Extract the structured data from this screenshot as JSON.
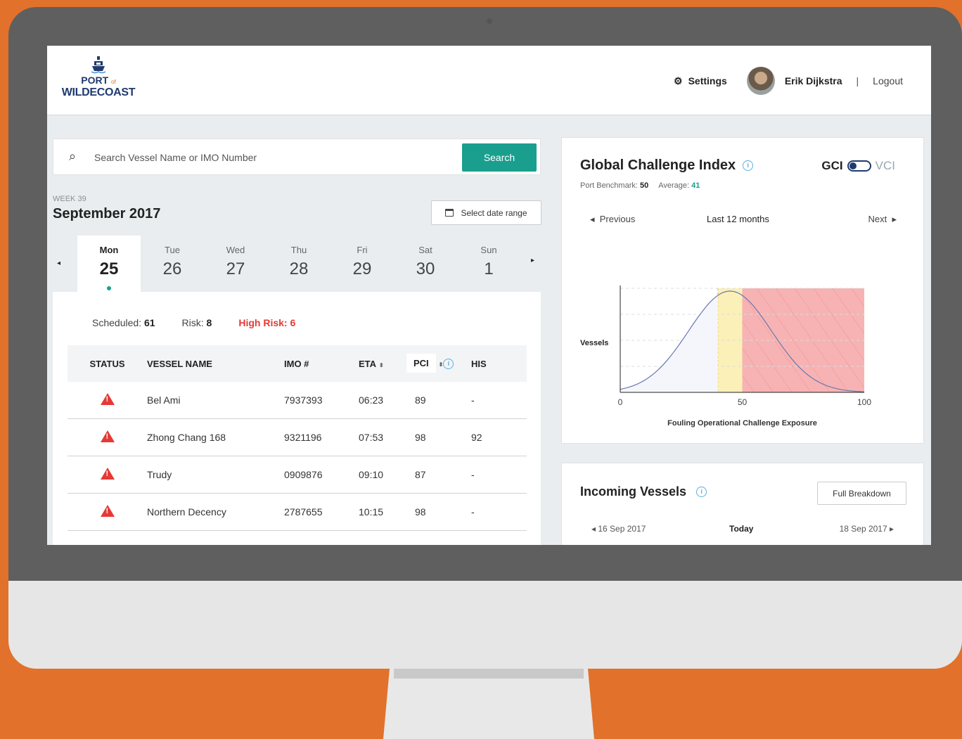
{
  "header": {
    "logo_top": "PORT",
    "logo_of": "of",
    "logo_bottom": "WILDECOAST",
    "settings_label": "Settings",
    "user_name": "Erik Dijkstra",
    "separator": "|",
    "logout_label": "Logout"
  },
  "search": {
    "placeholder": "Search Vessel Name or IMO Number",
    "value": "",
    "button_label": "Search"
  },
  "calendar": {
    "week_label": "WEEK 39",
    "month_title": "September 2017",
    "date_range_label": "Select date range",
    "prev_arrow": "◂",
    "next_arrow": "▸",
    "days": [
      {
        "name": "Mon",
        "num": "25",
        "active": true
      },
      {
        "name": "Tue",
        "num": "26"
      },
      {
        "name": "Wed",
        "num": "27"
      },
      {
        "name": "Thu",
        "num": "28"
      },
      {
        "name": "Fri",
        "num": "29"
      },
      {
        "name": "Sat",
        "num": "30"
      },
      {
        "name": "Sun",
        "num": "1"
      }
    ]
  },
  "counts": {
    "scheduled_label": "Scheduled:",
    "scheduled_value": "61",
    "risk_label": "Risk:",
    "risk_value": "8",
    "high_risk_label": "High Risk:",
    "high_risk_value": "6"
  },
  "table": {
    "headers": {
      "status": "STATUS",
      "name": "VESSEL NAME",
      "imo": "IMO #",
      "eta": "ETA",
      "pci": "PCI",
      "his": "HIS"
    },
    "rows": [
      {
        "name": "Bel Ami",
        "imo": "7937393",
        "eta": "06:23",
        "pci": "89",
        "his": "-"
      },
      {
        "name": "Zhong Chang 168",
        "imo": "9321196",
        "eta": "07:53",
        "pci": "98",
        "his": "92"
      },
      {
        "name": "Trudy",
        "imo": "0909876",
        "eta": "09:10",
        "pci": "87",
        "his": "-"
      },
      {
        "name": "Northern Decency",
        "imo": "2787655",
        "eta": "10:15",
        "pci": "98",
        "his": "-"
      }
    ]
  },
  "gci": {
    "title": "Global Challenge Index",
    "benchmark_label": "Port Benchmark:",
    "benchmark_value": "50",
    "average_label": "Average:",
    "average_value": "41",
    "toggle_on": "GCI",
    "toggle_off": "VCI",
    "prev_label": "Previous",
    "period_label": "Last 12 months",
    "next_label": "Next"
  },
  "chart_data": {
    "type": "area",
    "title": "",
    "xlabel": "Fouling Operational Challenge Exposure",
    "ylabel": "Vessels",
    "xlim": [
      0,
      100
    ],
    "x_ticks": [
      "0",
      "50",
      "100"
    ],
    "curve": {
      "shape": "bell",
      "peak_x": 45
    },
    "bands": [
      {
        "from": 40,
        "to": 50,
        "color": "#fbf0b8"
      },
      {
        "from": 50,
        "to": 100,
        "color": "#f7b3b3"
      }
    ],
    "colors": {
      "line": "#6a78b0",
      "fill_left": "#f4f6fb",
      "risk": "#f7b3b3",
      "warn": "#fbf0b8"
    }
  },
  "incoming": {
    "title": "Incoming Vessels",
    "full_breakdown_label": "Full Breakdown",
    "prev_date": "◂ 16 Sep 2017",
    "today": "Today",
    "next_date": "18 Sep 2017 ▸"
  },
  "colors": {
    "accent": "#1a9e8e",
    "danger": "#e53935",
    "brand": "#1f3a6e",
    "frame": "#e2712b"
  }
}
